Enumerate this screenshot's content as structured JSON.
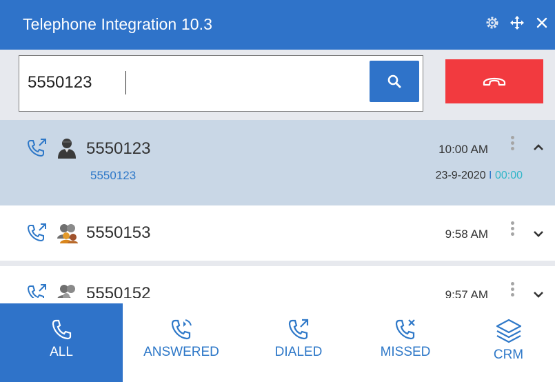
{
  "window": {
    "title": "Telephone Integration 10.3",
    "icons": [
      "gear-icon",
      "move-icon",
      "close-icon"
    ],
    "accent": "#2f73c9"
  },
  "search": {
    "value": "5550123",
    "button_icon": "search-icon",
    "hangup_icon": "hangup-icon",
    "hangup_color": "#f23a3f"
  },
  "calls": [
    {
      "number": "5550123",
      "contact": "5550123",
      "time": "10:00 AM",
      "date": "23-9-2020",
      "separator": "I",
      "duration": "00:00",
      "expanded": true,
      "type_icon": "outgoing-call-icon",
      "avatar_icon": "contact-avatar-icon"
    },
    {
      "number": "5550153",
      "time": "9:58 AM",
      "expanded": false,
      "type_icon": "outgoing-call-icon",
      "avatar_icon": "group-avatar-icon"
    },
    {
      "number": "5550152",
      "time": "9:57 AM",
      "expanded": false,
      "type_icon": "outgoing-call-icon",
      "avatar_icon": "group-avatar-icon"
    }
  ],
  "tabs": [
    {
      "label": "ALL",
      "icon": "phone-icon",
      "active": true
    },
    {
      "label": "ANSWERED",
      "icon": "phone-answered-icon",
      "active": false
    },
    {
      "label": "DIALED",
      "icon": "phone-dialed-icon",
      "active": false
    },
    {
      "label": "MISSED",
      "icon": "phone-missed-icon",
      "active": false
    },
    {
      "label": "CRM",
      "icon": "layers-icon",
      "active": false
    }
  ]
}
